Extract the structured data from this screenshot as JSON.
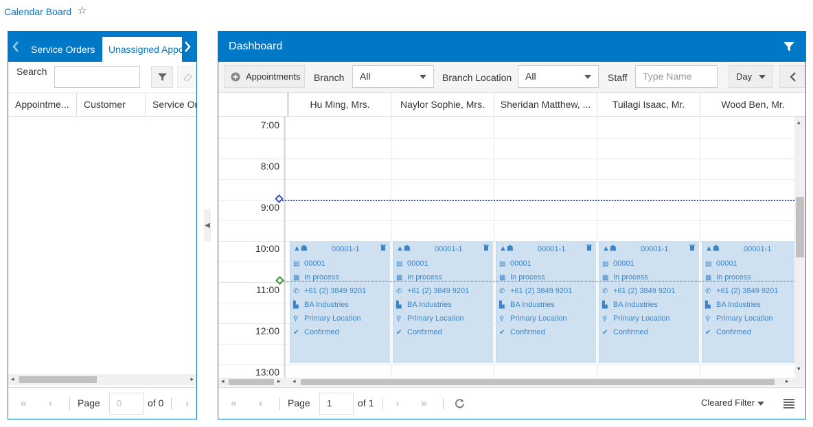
{
  "breadcrumb": {
    "title": "Calendar Board"
  },
  "left_panel": {
    "tabs": [
      {
        "label": "Service Orders"
      },
      {
        "label": "Unassigned Appo"
      }
    ],
    "search_label": "Search",
    "columns": [
      "Appointme...",
      "Customer",
      "Service Or"
    ],
    "pager": {
      "page_label": "Page",
      "page_value": "0",
      "of_label": "of 0"
    }
  },
  "right_panel": {
    "title": "Dashboard",
    "toolbar": {
      "appointments_label": "Appointments",
      "branch_label": "Branch",
      "branch_value": "All",
      "branch_location_label": "Branch Location",
      "branch_location_value": "All",
      "staff_label": "Staff",
      "staff_placeholder": "Type Name",
      "view_value": "Day"
    },
    "staff": [
      "Hu Ming, Mrs.",
      "Naylor Sophie, Mrs.",
      "Sheridan Matthew, ...",
      "Tuilagi Isaac, Mr.",
      "Wood Ben, Mr."
    ],
    "times": [
      "7:00",
      "8:00",
      "9:00",
      "10:00",
      "11:00",
      "12:00",
      "13:00"
    ],
    "appointments": [
      {
        "ref": "00001-1",
        "order": "00001",
        "status": "In process",
        "phone": "+61 (2) 3849 9201",
        "customer": "BA Industries",
        "location": "Primary Location",
        "confirmation": "Confirmed"
      },
      {
        "ref": "00001-1",
        "order": "00001",
        "status": "In process",
        "phone": "+61 (2) 3849 9201",
        "customer": "BA Industries",
        "location": "Primary Location",
        "confirmation": "Confirmed"
      },
      {
        "ref": "00001-1",
        "order": "00001",
        "status": "In process",
        "phone": "+61 (2) 3849 9201",
        "customer": "BA Industries",
        "location": "Primary Location",
        "confirmation": "Confirmed"
      },
      {
        "ref": "00001-1",
        "order": "00001",
        "status": "In process",
        "phone": "+61 (2) 3849 9201",
        "customer": "BA Industries",
        "location": "Primary Location",
        "confirmation": "Confirmed"
      },
      {
        "ref": "00001-1",
        "order": "00001",
        "status": "In process",
        "phone": "+61 (2) 3849 9201",
        "customer": "BA Industries",
        "location": "Primary Location",
        "confirmation": "Confirmed"
      }
    ],
    "pager": {
      "page_label": "Page",
      "page_value": "1",
      "of_label": "of 1",
      "filter_label": "Cleared Filter"
    }
  },
  "colors": {
    "accent": "#0078c8",
    "appointment_bg": "#cfe0f1",
    "appointment_text": "#3c84c4",
    "now_line": "#3a4fd0"
  }
}
